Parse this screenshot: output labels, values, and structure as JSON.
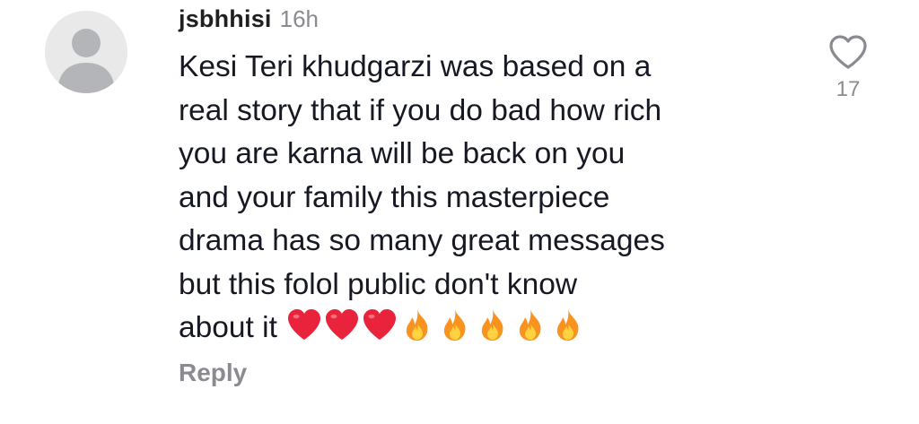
{
  "comment": {
    "username": "jsbhhisi",
    "time": "16h",
    "lines": [
      "Kesi Teri khudgarzi was based on a",
      "real story that if you do bad how rich",
      "you are karna will be back on you",
      "and your family this masterpiece",
      "drama has so many great messages",
      "but this folol public don't know",
      "about it"
    ],
    "emoji": [
      "red-heart",
      "red-heart",
      "red-heart",
      "fire",
      "fire",
      "fire",
      "fire",
      "fire"
    ],
    "reply_label": "Reply",
    "like_count": "17",
    "icons": {
      "avatar": "default-avatar-icon",
      "like": "heart-outline-icon"
    },
    "colors": {
      "heart": "#e8233b",
      "fire_outer": "#f7931e",
      "fire_inner": "#ffd23f",
      "muted": "#8a8b91",
      "avatar_bg": "#e9e9ea",
      "avatar_fg": "#b4b5b8"
    }
  }
}
